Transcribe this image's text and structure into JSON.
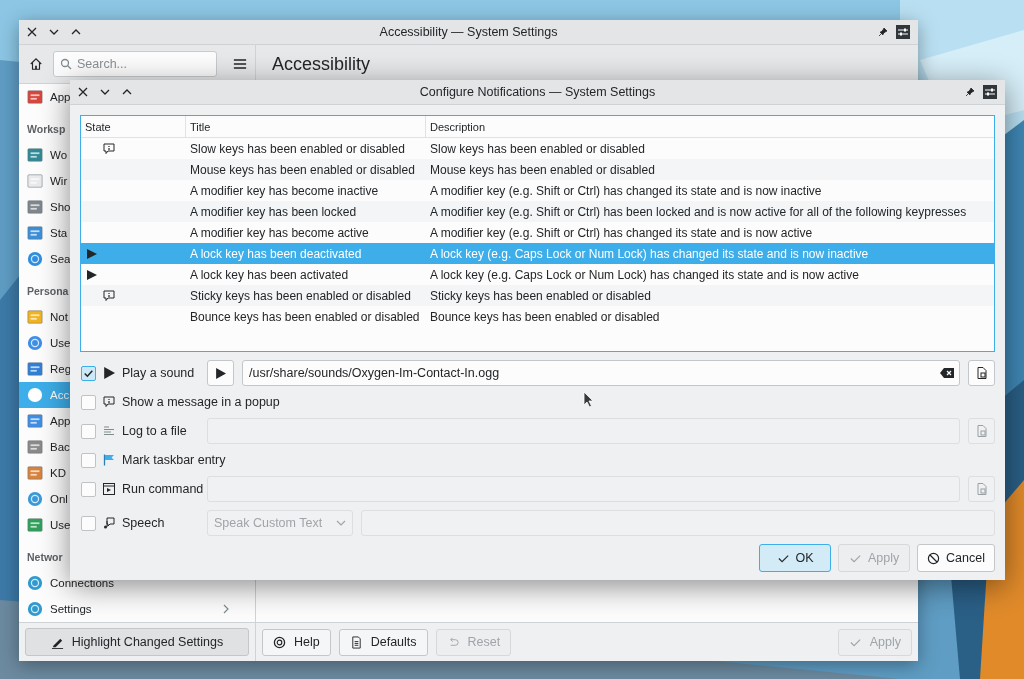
{
  "window": {
    "title": "Accessibility — System Settings"
  },
  "toolbar": {
    "search": {
      "placeholder": "Search..."
    }
  },
  "page_title": "Accessibility",
  "sidebar": {
    "items": [
      {
        "kind": "item",
        "label": "App",
        "selected": false
      },
      {
        "kind": "header",
        "label": "Worksp"
      },
      {
        "kind": "item",
        "label": "Wo",
        "selected": false
      },
      {
        "kind": "item",
        "label": "Wir",
        "selected": false
      },
      {
        "kind": "item",
        "label": "Sho",
        "selected": false
      },
      {
        "kind": "item",
        "label": "Sta",
        "selected": false
      },
      {
        "kind": "item",
        "label": "Sea",
        "selected": false
      },
      {
        "kind": "header",
        "label": "Persona"
      },
      {
        "kind": "item",
        "label": "Not",
        "selected": false
      },
      {
        "kind": "item",
        "label": "Use",
        "selected": false
      },
      {
        "kind": "item",
        "label": "Reg",
        "selected": false
      },
      {
        "kind": "item",
        "label": "Acc",
        "selected": true
      },
      {
        "kind": "item",
        "label": "App",
        "selected": false
      },
      {
        "kind": "item",
        "label": "Bac",
        "selected": false
      },
      {
        "kind": "item",
        "label": "KD",
        "selected": false
      },
      {
        "kind": "item",
        "label": "Onl",
        "selected": false
      },
      {
        "kind": "item",
        "label": "Use",
        "selected": false
      },
      {
        "kind": "header",
        "label": "Networ"
      },
      {
        "kind": "item",
        "label": "Connections",
        "selected": false,
        "expandable": false
      },
      {
        "kind": "item",
        "label": "Settings",
        "selected": false,
        "expandable": true
      }
    ],
    "footer_button": {
      "label": "Highlight Changed Settings"
    }
  },
  "footer_buttons": [
    {
      "kind": "help",
      "label": "Help",
      "disabled": false
    },
    {
      "kind": "defaults",
      "label": "Defaults",
      "disabled": false
    },
    {
      "kind": "reset",
      "label": "Reset",
      "disabled": true
    },
    {
      "kind": "apply",
      "label": "Apply",
      "disabled": true
    }
  ],
  "dialog": {
    "title": "Configure Notifications — System Settings",
    "table": {
      "columns": [
        "State",
        "Title",
        "Description"
      ],
      "rows": [
        {
          "popup": true,
          "sound": false,
          "title": "Slow keys has been enabled or disabled",
          "description": "Slow keys has been enabled or disabled",
          "selected": false
        },
        {
          "popup": false,
          "sound": false,
          "title": "Mouse keys has been enabled or disabled",
          "description": "Mouse keys has been enabled or disabled",
          "selected": false
        },
        {
          "popup": false,
          "sound": false,
          "title": "A modifier key has become inactive",
          "description": "A modifier key (e.g. Shift or Ctrl) has changed its state and is now inactive",
          "selected": false
        },
        {
          "popup": false,
          "sound": false,
          "title": "A modifier key has been locked",
          "description": "A modifier key (e.g. Shift or Ctrl) has been locked and is now active for all of the following keypresses",
          "selected": false
        },
        {
          "popup": false,
          "sound": false,
          "title": "A modifier key has become active",
          "description": "A modifier key (e.g. Shift or Ctrl) has changed its state and is now active",
          "selected": false
        },
        {
          "popup": false,
          "sound": true,
          "title": "A lock key has been deactivated",
          "description": "A lock key (e.g. Caps Lock or Num Lock) has changed its state and is now inactive",
          "selected": true
        },
        {
          "popup": false,
          "sound": true,
          "title": "A lock key has been activated",
          "description": "A lock key (e.g. Caps Lock or Num Lock) has changed its state and is now active",
          "selected": false
        },
        {
          "popup": true,
          "sound": false,
          "title": "Sticky keys has been enabled or disabled",
          "description": "Sticky keys has been enabled or disabled",
          "selected": false
        },
        {
          "popup": false,
          "sound": false,
          "title": "Bounce keys has been enabled or disabled",
          "description": "Bounce keys has been enabled or disabled",
          "selected": false
        }
      ]
    },
    "actions": [
      {
        "kind": "sound",
        "label": "Play a sound",
        "checked": true,
        "value": "/usr/share/sounds/Oxygen-Im-Contact-In.ogg"
      },
      {
        "kind": "popup",
        "label": "Show a message in a popup",
        "checked": false
      },
      {
        "kind": "log",
        "label": "Log to a file",
        "checked": false
      },
      {
        "kind": "taskbar",
        "label": "Mark taskbar entry",
        "checked": false
      },
      {
        "kind": "command",
        "label": "Run command",
        "checked": false
      },
      {
        "kind": "speech",
        "label": "Speech",
        "checked": false,
        "option": "Speak Custom Text"
      }
    ],
    "buttons": [
      {
        "kind": "ok",
        "label": "OK",
        "disabled": false,
        "default": true
      },
      {
        "kind": "apply",
        "label": "Apply",
        "disabled": true,
        "default": false
      },
      {
        "kind": "cancel",
        "label": "Cancel",
        "disabled": false,
        "default": false
      }
    ]
  }
}
